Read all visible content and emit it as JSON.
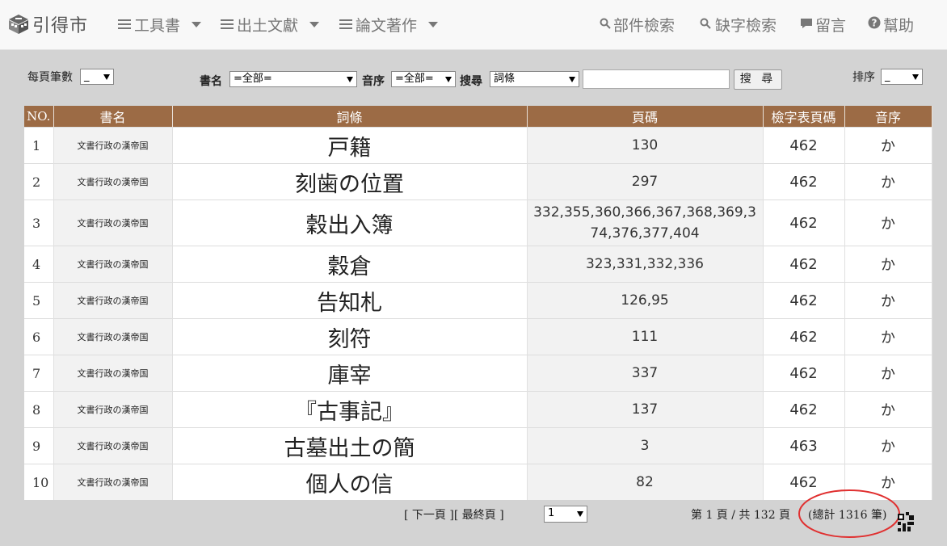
{
  "nav": {
    "brand": "引得市",
    "menus": [
      {
        "label": "工具書"
      },
      {
        "label": "出土文獻"
      },
      {
        "label": "論文著作"
      }
    ],
    "right": [
      {
        "label": "部件檢索",
        "icon": "search-icon"
      },
      {
        "label": "缺字檢索",
        "icon": "search-icon"
      },
      {
        "label": "留言",
        "icon": "comment-icon"
      },
      {
        "label": "幫助",
        "icon": "question-circle-icon"
      }
    ]
  },
  "filters": {
    "per_page_label": "每頁筆數",
    "per_page_value": "_",
    "book_label": "書名",
    "book_value": "=全部=",
    "phon_label": "音序",
    "phon_value": "=全部=",
    "search_label": "搜尋",
    "search_field_value": "詞條",
    "search_input_value": "",
    "search_button": "搜 尋",
    "sort_label": "排序",
    "sort_value": "_"
  },
  "table": {
    "headers": [
      "NO.",
      "書名",
      "詞條",
      "頁碼",
      "檢字表頁碼",
      "音序"
    ],
    "rows": [
      {
        "no": "1",
        "book": "文書行政の漢帝国",
        "entry": "戸籍",
        "pages": "130",
        "index_page": "462",
        "phon": "か"
      },
      {
        "no": "2",
        "book": "文書行政の漢帝国",
        "entry": "刻歯の位置",
        "pages": "297",
        "index_page": "462",
        "phon": "か"
      },
      {
        "no": "3",
        "book": "文書行政の漢帝国",
        "entry": "穀出入簿",
        "pages": "332,355,360,366,367,368,369,374,376,377,404",
        "index_page": "462",
        "phon": "か"
      },
      {
        "no": "4",
        "book": "文書行政の漢帝国",
        "entry": "穀倉",
        "pages": "323,331,332,336",
        "index_page": "462",
        "phon": "か"
      },
      {
        "no": "5",
        "book": "文書行政の漢帝国",
        "entry": "告知札",
        "pages": "126,95",
        "index_page": "462",
        "phon": "か"
      },
      {
        "no": "6",
        "book": "文書行政の漢帝国",
        "entry": "刻符",
        "pages": "111",
        "index_page": "462",
        "phon": "か"
      },
      {
        "no": "7",
        "book": "文書行政の漢帝国",
        "entry": "庫宰",
        "pages": "337",
        "index_page": "462",
        "phon": "か"
      },
      {
        "no": "8",
        "book": "文書行政の漢帝国",
        "entry": "『古事記』",
        "pages": "137",
        "index_page": "462",
        "phon": "か"
      },
      {
        "no": "9",
        "book": "文書行政の漢帝国",
        "entry": "古墓出土の簡",
        "pages": "3",
        "index_page": "463",
        "phon": "か"
      },
      {
        "no": "10",
        "book": "文書行政の漢帝国",
        "entry": "個人の信",
        "pages": "82",
        "index_page": "462",
        "phon": "か"
      }
    ]
  },
  "pager": {
    "next": "[ 下一頁 ]",
    "last": "[ 最終頁 ]",
    "page_select": "1",
    "page_info": "第 1 頁 / 共 132 頁",
    "total": "(總計 1316 筆)"
  },
  "colors": {
    "header_bg": "#9c6b45",
    "annotation_circle": "#e03030"
  }
}
